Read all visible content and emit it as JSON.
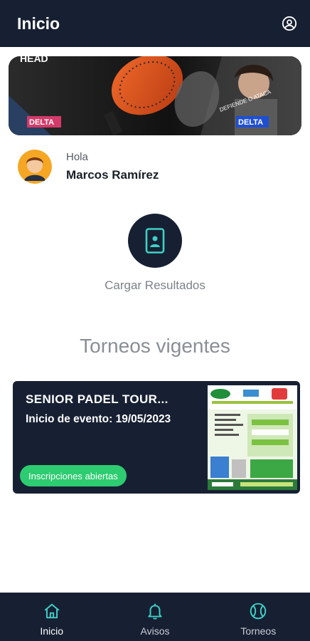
{
  "app_bar": {
    "title": "Inicio",
    "profile_icon": "account-circle-icon"
  },
  "banner": {
    "brand": "HEAD",
    "product": "DELTA",
    "tagline": "DEFIENDE O ATACA"
  },
  "greeting": {
    "hello": "Hola",
    "name": "Marcos Ramírez"
  },
  "upload": {
    "label": "Cargar Resultados",
    "icon": "phone-upload-icon"
  },
  "section_title": "Torneos vigentes",
  "tournaments": [
    {
      "title": "SENIOR PADEL TOUR...",
      "date_label": "Inicio de evento: 19/05/2023",
      "badge": "Inscripciones abiertas"
    }
  ],
  "bottom_nav": [
    {
      "label": "Inicio",
      "icon": "home-icon",
      "active": true
    },
    {
      "label": "Avisos",
      "icon": "bell-icon",
      "active": false
    },
    {
      "label": "Torneos",
      "icon": "tennis-ball-icon",
      "active": false
    }
  ],
  "colors": {
    "primary_dark": "#172033",
    "accent_teal": "#3fd0c6",
    "badge_green": "#2ecc71",
    "muted_text": "#8a8e95"
  }
}
